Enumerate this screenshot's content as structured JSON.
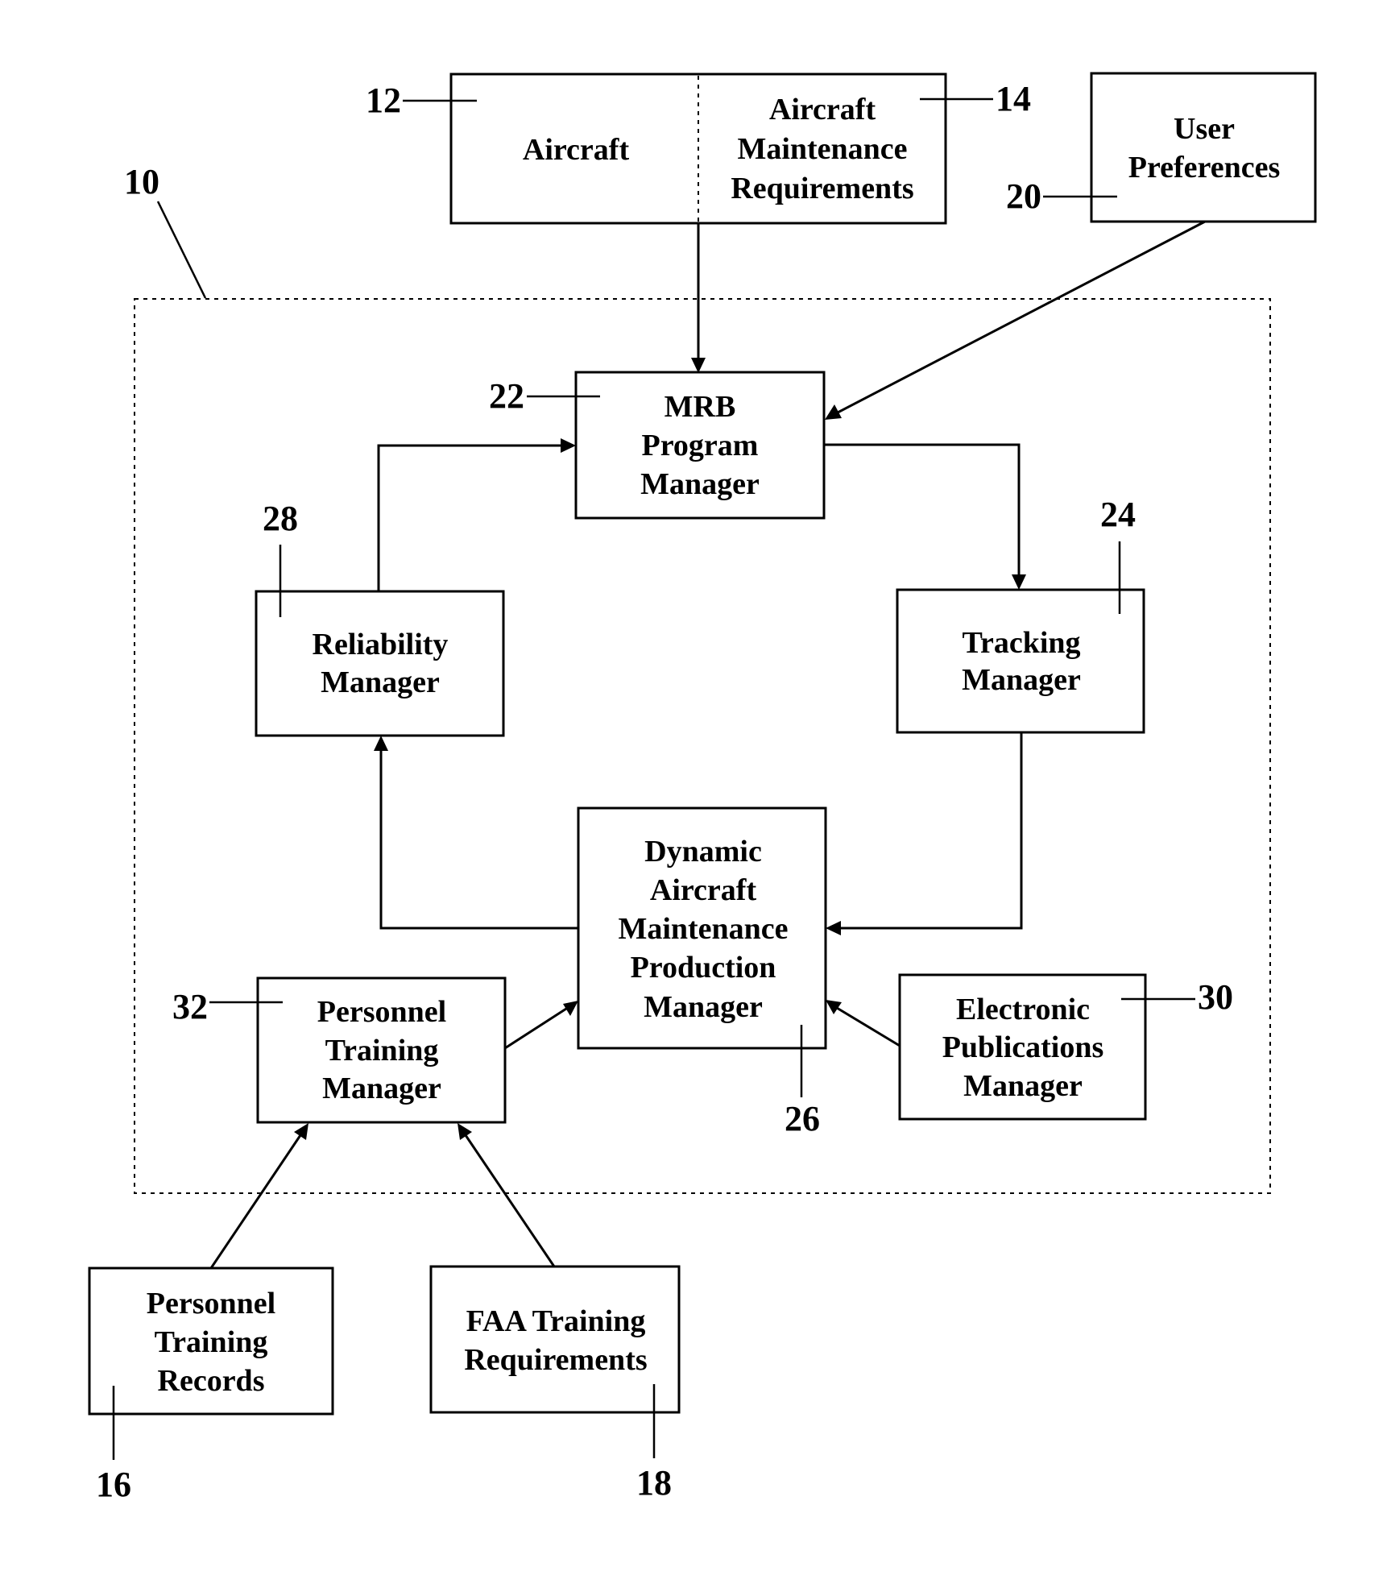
{
  "figure": {
    "system": {
      "ref": "10"
    },
    "blocks": {
      "aircraft": {
        "ref": "12",
        "lines": [
          "Aircraft"
        ]
      },
      "maintenance_requirements": {
        "ref": "14",
        "lines": [
          "Aircraft",
          "Maintenance",
          "Requirements"
        ]
      },
      "user_preferences": {
        "ref": "20",
        "lines": [
          "User",
          "Preferences"
        ]
      },
      "mrb_program_manager": {
        "ref": "22",
        "lines": [
          "MRB",
          "Program",
          "Manager"
        ]
      },
      "tracking_manager": {
        "ref": "24",
        "lines": [
          "Tracking",
          "Manager"
        ]
      },
      "reliability_manager": {
        "ref": "28",
        "lines": [
          "Reliability",
          "Manager"
        ]
      },
      "production_manager": {
        "ref": "26",
        "lines": [
          "Dynamic",
          "Aircraft",
          "Maintenance",
          "Production",
          "Manager"
        ]
      },
      "personnel_training_manager": {
        "ref": "32",
        "lines": [
          "Personnel",
          "Training",
          "Manager"
        ]
      },
      "electronic_publications_manager": {
        "ref": "30",
        "lines": [
          "Electronic",
          "Publications",
          "Manager"
        ]
      },
      "personnel_training_records": {
        "ref": "16",
        "lines": [
          "Personnel",
          "Training",
          "Records"
        ]
      },
      "faa_training_requirements": {
        "ref": "18",
        "lines": [
          "FAA Training",
          "Requirements"
        ]
      }
    },
    "connections": [
      {
        "from": "aircraft_maintenance_input",
        "to": "mrb_program_manager"
      },
      {
        "from": "user_preferences",
        "to": "mrb_program_manager"
      },
      {
        "from": "mrb_program_manager",
        "to": "tracking_manager"
      },
      {
        "from": "tracking_manager",
        "to": "production_manager"
      },
      {
        "from": "production_manager",
        "to": "reliability_manager"
      },
      {
        "from": "reliability_manager",
        "to": "mrb_program_manager"
      },
      {
        "from": "personnel_training_manager",
        "to": "production_manager"
      },
      {
        "from": "electronic_publications_manager",
        "to": "production_manager"
      },
      {
        "from": "personnel_training_records",
        "to": "personnel_training_manager"
      },
      {
        "from": "faa_training_requirements",
        "to": "personnel_training_manager"
      }
    ]
  }
}
